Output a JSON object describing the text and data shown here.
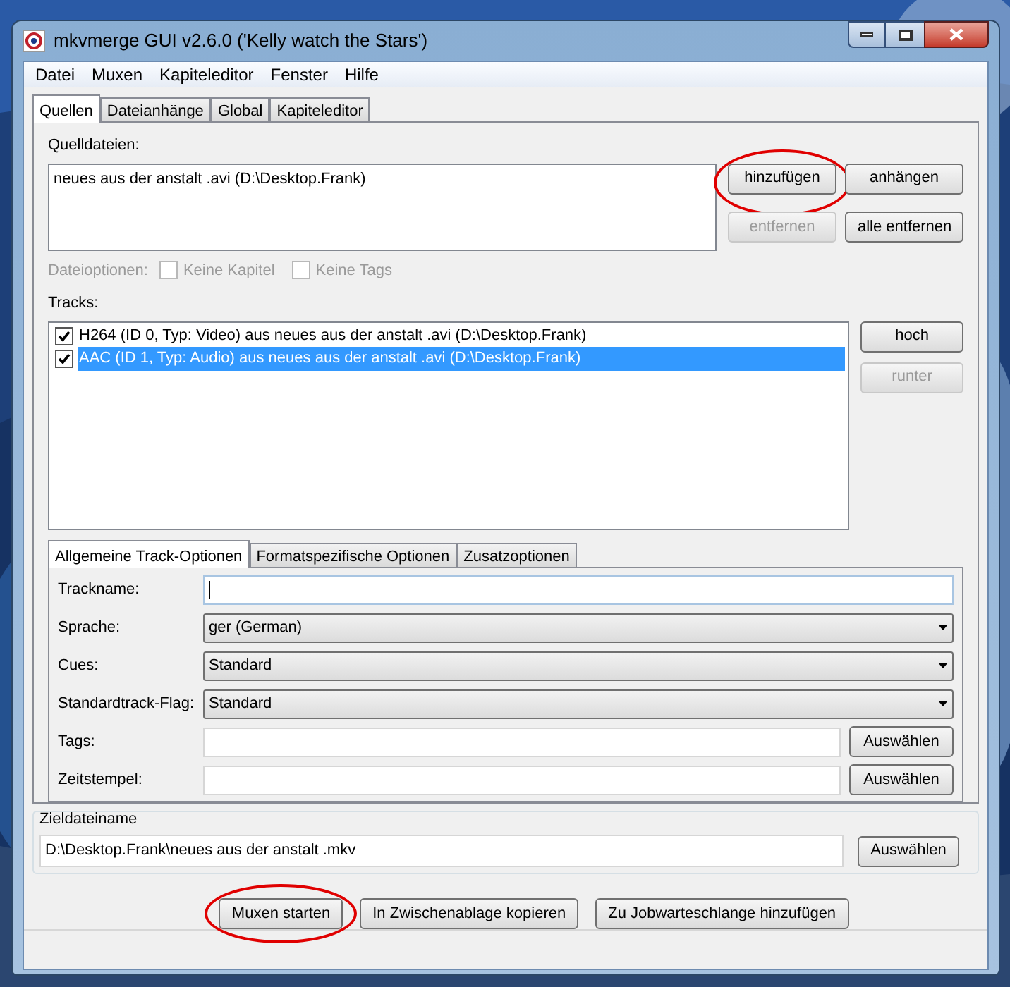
{
  "window": {
    "title": "mkvmerge GUI v2.6.0 ('Kelly watch the Stars')"
  },
  "menu": [
    "Datei",
    "Muxen",
    "Kapiteleditor",
    "Fenster",
    "Hilfe"
  ],
  "tabs": [
    {
      "label": "Quellen",
      "selected": true
    },
    {
      "label": "Dateianhänge",
      "selected": false
    },
    {
      "label": "Global",
      "selected": false
    },
    {
      "label": "Kapiteleditor",
      "selected": false
    }
  ],
  "sources": {
    "label": "Quelldateien:",
    "files": [
      "neues aus der anstalt .avi (D:\\Desktop.Frank)"
    ],
    "buttons": [
      {
        "label": "hinzufügen",
        "disabled": false,
        "highlighted": true
      },
      {
        "label": "anhängen",
        "disabled": false,
        "highlighted": false
      },
      {
        "label": "entfernen",
        "disabled": true,
        "highlighted": false
      },
      {
        "label": "alle entfernen",
        "disabled": false,
        "highlighted": false
      }
    ]
  },
  "file_options": {
    "label": "Dateioptionen:",
    "disabled": true,
    "checkboxes": [
      {
        "label": "Keine Kapitel",
        "checked": false
      },
      {
        "label": "Keine Tags",
        "checked": false
      }
    ]
  },
  "tracks": {
    "label": "Tracks:",
    "items": [
      {
        "label": "H264 (ID 0, Typ: Video) aus neues aus der anstalt .avi (D:\\Desktop.Frank)",
        "checked": true,
        "selected": false
      },
      {
        "label": "AAC (ID 1, Typ: Audio) aus neues aus der anstalt .avi (D:\\Desktop.Frank)",
        "checked": true,
        "selected": true
      }
    ],
    "buttons": [
      {
        "label": "hoch",
        "disabled": false
      },
      {
        "label": "runter",
        "disabled": true
      }
    ]
  },
  "track_tabs": [
    {
      "label": "Allgemeine Track-Optionen",
      "selected": true
    },
    {
      "label": "Formatspezifische Optionen",
      "selected": false
    },
    {
      "label": "Zusatzoptionen",
      "selected": false
    }
  ],
  "track_options": [
    {
      "kind": "text",
      "label": "Trackname:"
    },
    {
      "kind": "select",
      "label": "Sprache:",
      "value": "ger (German)"
    },
    {
      "kind": "select",
      "label": "Cues:",
      "value": "Standard"
    },
    {
      "kind": "select",
      "label": "Standardtrack-Flag:",
      "value": "Standard"
    },
    {
      "kind": "file",
      "label": "Tags:",
      "button": "Auswählen"
    },
    {
      "kind": "file",
      "label": "Zeitstempel:",
      "button": "Auswählen"
    }
  ],
  "output": {
    "label": "Zieldateiname",
    "value": "D:\\Desktop.Frank\\neues aus der anstalt .mkv",
    "button": "Auswählen"
  },
  "actions": [
    {
      "label": "Muxen starten",
      "highlighted": true
    },
    {
      "label": "In Zwischenablage kopieren",
      "highlighted": false
    },
    {
      "label": "Zu Jobwarteschlange hinzufügen",
      "highlighted": false
    }
  ]
}
